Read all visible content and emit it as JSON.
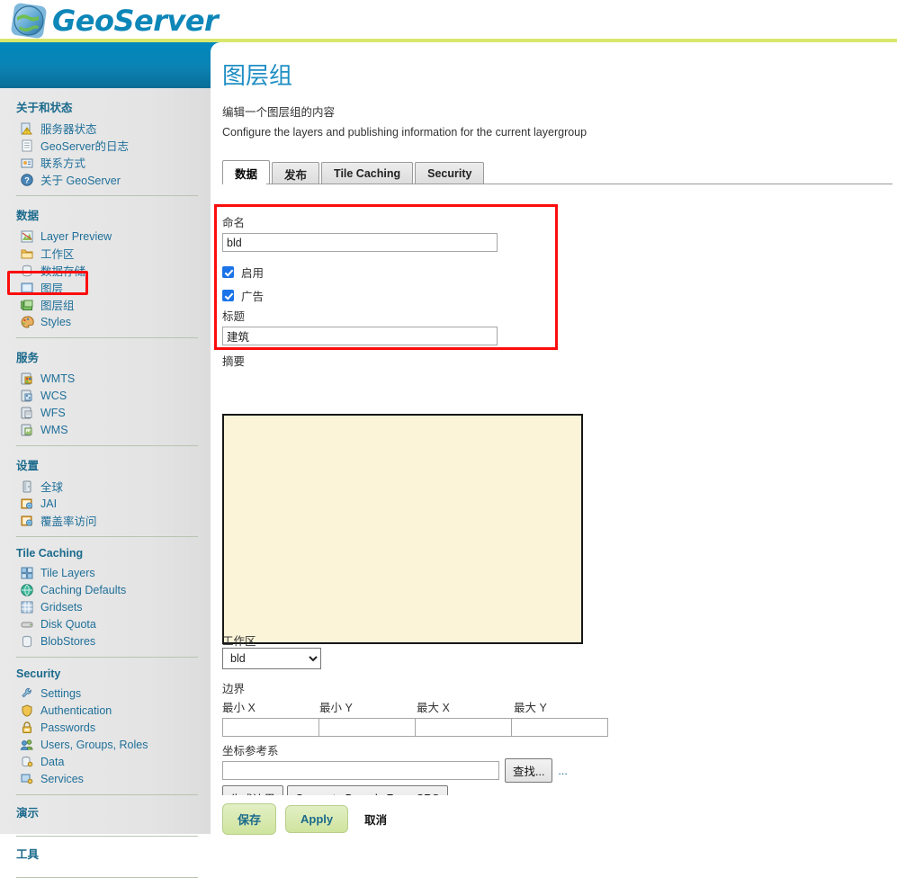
{
  "brand": {
    "name": "GeoServer",
    "logo_icon": "globe-icon",
    "accent": "#0d86b8",
    "banner_green": "#d9e86b",
    "banner_blue": "#0089bd"
  },
  "sidebar": {
    "sections": [
      {
        "title": "关于和状态",
        "items": [
          {
            "label": "服务器状态",
            "icon": "server-status-icon"
          },
          {
            "label": "GeoServer的日志",
            "icon": "document-icon"
          },
          {
            "label": "联系方式",
            "icon": "contact-card-icon"
          },
          {
            "label": "关于 GeoServer",
            "icon": "info-icon"
          }
        ]
      },
      {
        "title": "数据",
        "items": [
          {
            "label": "Layer Preview",
            "icon": "layer-preview-icon"
          },
          {
            "label": "工作区",
            "icon": "folder-icon"
          },
          {
            "label": "数据存储",
            "icon": "database-icon"
          },
          {
            "label": "图层",
            "icon": "layer-icon"
          },
          {
            "label": "图层组",
            "icon": "layer-group-icon"
          },
          {
            "label": "Styles",
            "icon": "palette-icon"
          }
        ]
      },
      {
        "title": "服务",
        "items": [
          {
            "label": "WMTS",
            "icon": "service-icon"
          },
          {
            "label": "WCS",
            "icon": "service-icon"
          },
          {
            "label": "WFS",
            "icon": "service-icon"
          },
          {
            "label": "WMS",
            "icon": "service-icon"
          }
        ]
      },
      {
        "title": "设置",
        "items": [
          {
            "label": "全球",
            "icon": "globe-settings-icon"
          },
          {
            "label": "JAI",
            "icon": "jai-icon"
          },
          {
            "label": "覆盖率访问",
            "icon": "coverage-icon"
          }
        ]
      },
      {
        "title": "Tile Caching",
        "items": [
          {
            "label": "Tile Layers",
            "icon": "tile-layers-icon"
          },
          {
            "label": "Caching Defaults",
            "icon": "caching-globe-icon"
          },
          {
            "label": "Gridsets",
            "icon": "grid-icon"
          },
          {
            "label": "Disk Quota",
            "icon": "disk-icon"
          },
          {
            "label": "BlobStores",
            "icon": "blobstore-icon"
          }
        ]
      },
      {
        "title": "Security",
        "items": [
          {
            "label": "Settings",
            "icon": "wrench-icon"
          },
          {
            "label": "Authentication",
            "icon": "shield-icon"
          },
          {
            "label": "Passwords",
            "icon": "lock-icon"
          },
          {
            "label": "Users, Groups, Roles",
            "icon": "users-icon"
          },
          {
            "label": "Data",
            "icon": "data-key-icon"
          },
          {
            "label": "Services",
            "icon": "services-key-icon"
          }
        ]
      }
    ],
    "plain_sections": [
      {
        "title": "演示"
      },
      {
        "title": "工具"
      }
    ],
    "highlight_color": "#fc0d0d"
  },
  "page": {
    "title": "图层组",
    "subtitle_cn": "编辑一个图层组的内容",
    "subtitle_en": "Configure the layers and publishing information for the current layergroup"
  },
  "tabs": [
    {
      "label": "数据",
      "active": true
    },
    {
      "label": "发布",
      "active": false
    },
    {
      "label": "Tile Caching",
      "active": false
    },
    {
      "label": "Security",
      "active": false
    }
  ],
  "form": {
    "name_label": "命名",
    "name_value": "bld",
    "enabled_label": "启用",
    "enabled_checked": true,
    "advertised_label": "广告",
    "advertised_checked": true,
    "title_label": "标题",
    "title_value": "建筑",
    "abstract_label": "摘要",
    "abstract_value": "",
    "workspace_label": "工作区",
    "workspace_value": "bld",
    "bounds_label": "边界",
    "bounds_headers": [
      "最小 X",
      "最小 Y",
      "最大 X",
      "最大 Y"
    ],
    "bounds_values": [
      "",
      "",
      "",
      ""
    ],
    "crs_label": "坐标参考系",
    "crs_value": "",
    "crs_find_button": "查找...",
    "crs_more": "...",
    "generate_bounds_button": "生成边界",
    "generate_bounds_crs_button": "Generate Bounds From CRS",
    "highlight_color": "#fc0d0d"
  },
  "actions": {
    "save_label": "保存",
    "apply_label": "Apply",
    "cancel_label": "取消"
  }
}
